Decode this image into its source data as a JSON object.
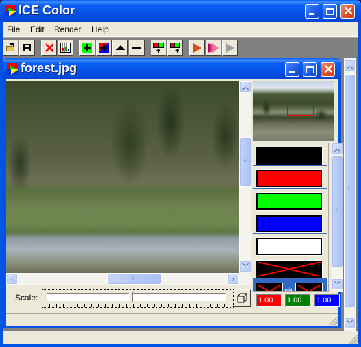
{
  "app": {
    "title": "ICE Color",
    "icon": "ice-color-app-icon",
    "caption_buttons": [
      "minimize",
      "maximize",
      "close"
    ]
  },
  "menu": {
    "items": [
      {
        "label": "File"
      },
      {
        "label": "Edit"
      },
      {
        "label": "Render"
      },
      {
        "label": "Help"
      }
    ]
  },
  "toolbar": {
    "buttons": [
      {
        "name": "open",
        "icon": "open-folder-icon"
      },
      {
        "name": "save",
        "icon": "floppy-disk-icon"
      },
      {
        "name": "delete",
        "icon": "red-x-icon"
      },
      {
        "name": "palette-grid",
        "icon": "palette-grid-icon"
      },
      {
        "name": "add-color-green",
        "icon": "green-plus-icon"
      },
      {
        "name": "add-color-rgb",
        "icon": "rgb-plus-icon"
      },
      {
        "name": "move-up",
        "icon": "triangle-up-icon"
      },
      {
        "name": "remove",
        "icon": "minus-icon"
      },
      {
        "name": "apply-color-1",
        "icon": "red-green-arrow-up-icon"
      },
      {
        "name": "apply-color-2",
        "icon": "red-green-arrow-up-icon"
      },
      {
        "name": "render",
        "icon": "play-orange-icon"
      },
      {
        "name": "render-all",
        "icon": "fast-forward-pink-icon"
      },
      {
        "name": "render-disabled",
        "icon": "play-grey-icon"
      }
    ]
  },
  "document": {
    "title": "forest.jpg",
    "scale_label": "Scale:",
    "scale_value_fraction": 0.47,
    "vscroll_position_fraction": 0.35,
    "hscroll_position_fraction": 0.45,
    "palette": [
      {
        "name": "black",
        "color": "#000000",
        "type": "solid"
      },
      {
        "name": "red",
        "color": "#ff0000",
        "type": "solid"
      },
      {
        "name": "green",
        "color": "#00ff00",
        "type": "solid"
      },
      {
        "name": "blue",
        "color": "#0000ff",
        "type": "solid"
      },
      {
        "name": "white",
        "color": "#ffffff",
        "type": "solid"
      },
      {
        "name": "none",
        "color": "#000000",
        "type": "crossed"
      },
      {
        "name": "transition",
        "color": "#000000",
        "type": "transition",
        "selected": true
      }
    ],
    "channels": [
      {
        "label": "1.00",
        "color": "#ff0000"
      },
      {
        "label": "1.00",
        "color": "#008000"
      },
      {
        "label": "1.00",
        "color": "#0000ff"
      }
    ]
  },
  "status": {
    "text": ""
  }
}
